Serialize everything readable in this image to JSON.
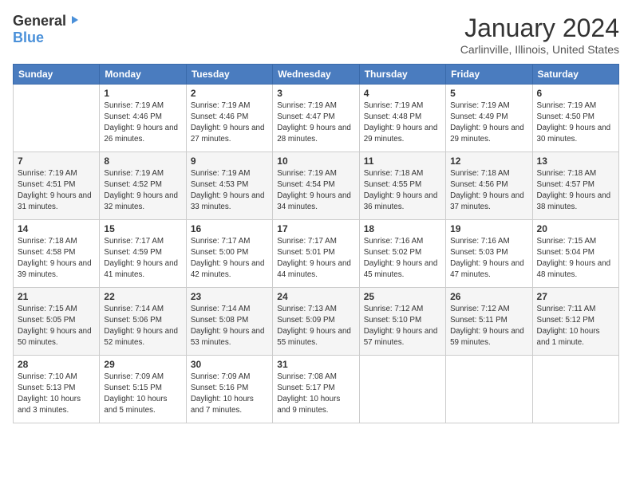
{
  "header": {
    "logo_general": "General",
    "logo_blue": "Blue",
    "title": "January 2024",
    "subtitle": "Carlinville, Illinois, United States"
  },
  "days_of_week": [
    "Sunday",
    "Monday",
    "Tuesday",
    "Wednesday",
    "Thursday",
    "Friday",
    "Saturday"
  ],
  "weeks": [
    [
      {
        "date": "",
        "sunrise": "",
        "sunset": "",
        "daylight": ""
      },
      {
        "date": "1",
        "sunrise": "Sunrise: 7:19 AM",
        "sunset": "Sunset: 4:46 PM",
        "daylight": "Daylight: 9 hours and 26 minutes."
      },
      {
        "date": "2",
        "sunrise": "Sunrise: 7:19 AM",
        "sunset": "Sunset: 4:46 PM",
        "daylight": "Daylight: 9 hours and 27 minutes."
      },
      {
        "date": "3",
        "sunrise": "Sunrise: 7:19 AM",
        "sunset": "Sunset: 4:47 PM",
        "daylight": "Daylight: 9 hours and 28 minutes."
      },
      {
        "date": "4",
        "sunrise": "Sunrise: 7:19 AM",
        "sunset": "Sunset: 4:48 PM",
        "daylight": "Daylight: 9 hours and 29 minutes."
      },
      {
        "date": "5",
        "sunrise": "Sunrise: 7:19 AM",
        "sunset": "Sunset: 4:49 PM",
        "daylight": "Daylight: 9 hours and 29 minutes."
      },
      {
        "date": "6",
        "sunrise": "Sunrise: 7:19 AM",
        "sunset": "Sunset: 4:50 PM",
        "daylight": "Daylight: 9 hours and 30 minutes."
      }
    ],
    [
      {
        "date": "7",
        "sunrise": "Sunrise: 7:19 AM",
        "sunset": "Sunset: 4:51 PM",
        "daylight": "Daylight: 9 hours and 31 minutes."
      },
      {
        "date": "8",
        "sunrise": "Sunrise: 7:19 AM",
        "sunset": "Sunset: 4:52 PM",
        "daylight": "Daylight: 9 hours and 32 minutes."
      },
      {
        "date": "9",
        "sunrise": "Sunrise: 7:19 AM",
        "sunset": "Sunset: 4:53 PM",
        "daylight": "Daylight: 9 hours and 33 minutes."
      },
      {
        "date": "10",
        "sunrise": "Sunrise: 7:19 AM",
        "sunset": "Sunset: 4:54 PM",
        "daylight": "Daylight: 9 hours and 34 minutes."
      },
      {
        "date": "11",
        "sunrise": "Sunrise: 7:18 AM",
        "sunset": "Sunset: 4:55 PM",
        "daylight": "Daylight: 9 hours and 36 minutes."
      },
      {
        "date": "12",
        "sunrise": "Sunrise: 7:18 AM",
        "sunset": "Sunset: 4:56 PM",
        "daylight": "Daylight: 9 hours and 37 minutes."
      },
      {
        "date": "13",
        "sunrise": "Sunrise: 7:18 AM",
        "sunset": "Sunset: 4:57 PM",
        "daylight": "Daylight: 9 hours and 38 minutes."
      }
    ],
    [
      {
        "date": "14",
        "sunrise": "Sunrise: 7:18 AM",
        "sunset": "Sunset: 4:58 PM",
        "daylight": "Daylight: 9 hours and 39 minutes."
      },
      {
        "date": "15",
        "sunrise": "Sunrise: 7:17 AM",
        "sunset": "Sunset: 4:59 PM",
        "daylight": "Daylight: 9 hours and 41 minutes."
      },
      {
        "date": "16",
        "sunrise": "Sunrise: 7:17 AM",
        "sunset": "Sunset: 5:00 PM",
        "daylight": "Daylight: 9 hours and 42 minutes."
      },
      {
        "date": "17",
        "sunrise": "Sunrise: 7:17 AM",
        "sunset": "Sunset: 5:01 PM",
        "daylight": "Daylight: 9 hours and 44 minutes."
      },
      {
        "date": "18",
        "sunrise": "Sunrise: 7:16 AM",
        "sunset": "Sunset: 5:02 PM",
        "daylight": "Daylight: 9 hours and 45 minutes."
      },
      {
        "date": "19",
        "sunrise": "Sunrise: 7:16 AM",
        "sunset": "Sunset: 5:03 PM",
        "daylight": "Daylight: 9 hours and 47 minutes."
      },
      {
        "date": "20",
        "sunrise": "Sunrise: 7:15 AM",
        "sunset": "Sunset: 5:04 PM",
        "daylight": "Daylight: 9 hours and 48 minutes."
      }
    ],
    [
      {
        "date": "21",
        "sunrise": "Sunrise: 7:15 AM",
        "sunset": "Sunset: 5:05 PM",
        "daylight": "Daylight: 9 hours and 50 minutes."
      },
      {
        "date": "22",
        "sunrise": "Sunrise: 7:14 AM",
        "sunset": "Sunset: 5:06 PM",
        "daylight": "Daylight: 9 hours and 52 minutes."
      },
      {
        "date": "23",
        "sunrise": "Sunrise: 7:14 AM",
        "sunset": "Sunset: 5:08 PM",
        "daylight": "Daylight: 9 hours and 53 minutes."
      },
      {
        "date": "24",
        "sunrise": "Sunrise: 7:13 AM",
        "sunset": "Sunset: 5:09 PM",
        "daylight": "Daylight: 9 hours and 55 minutes."
      },
      {
        "date": "25",
        "sunrise": "Sunrise: 7:12 AM",
        "sunset": "Sunset: 5:10 PM",
        "daylight": "Daylight: 9 hours and 57 minutes."
      },
      {
        "date": "26",
        "sunrise": "Sunrise: 7:12 AM",
        "sunset": "Sunset: 5:11 PM",
        "daylight": "Daylight: 9 hours and 59 minutes."
      },
      {
        "date": "27",
        "sunrise": "Sunrise: 7:11 AM",
        "sunset": "Sunset: 5:12 PM",
        "daylight": "Daylight: 10 hours and 1 minute."
      }
    ],
    [
      {
        "date": "28",
        "sunrise": "Sunrise: 7:10 AM",
        "sunset": "Sunset: 5:13 PM",
        "daylight": "Daylight: 10 hours and 3 minutes."
      },
      {
        "date": "29",
        "sunrise": "Sunrise: 7:09 AM",
        "sunset": "Sunset: 5:15 PM",
        "daylight": "Daylight: 10 hours and 5 minutes."
      },
      {
        "date": "30",
        "sunrise": "Sunrise: 7:09 AM",
        "sunset": "Sunset: 5:16 PM",
        "daylight": "Daylight: 10 hours and 7 minutes."
      },
      {
        "date": "31",
        "sunrise": "Sunrise: 7:08 AM",
        "sunset": "Sunset: 5:17 PM",
        "daylight": "Daylight: 10 hours and 9 minutes."
      },
      {
        "date": "",
        "sunrise": "",
        "sunset": "",
        "daylight": ""
      },
      {
        "date": "",
        "sunrise": "",
        "sunset": "",
        "daylight": ""
      },
      {
        "date": "",
        "sunrise": "",
        "sunset": "",
        "daylight": ""
      }
    ]
  ]
}
